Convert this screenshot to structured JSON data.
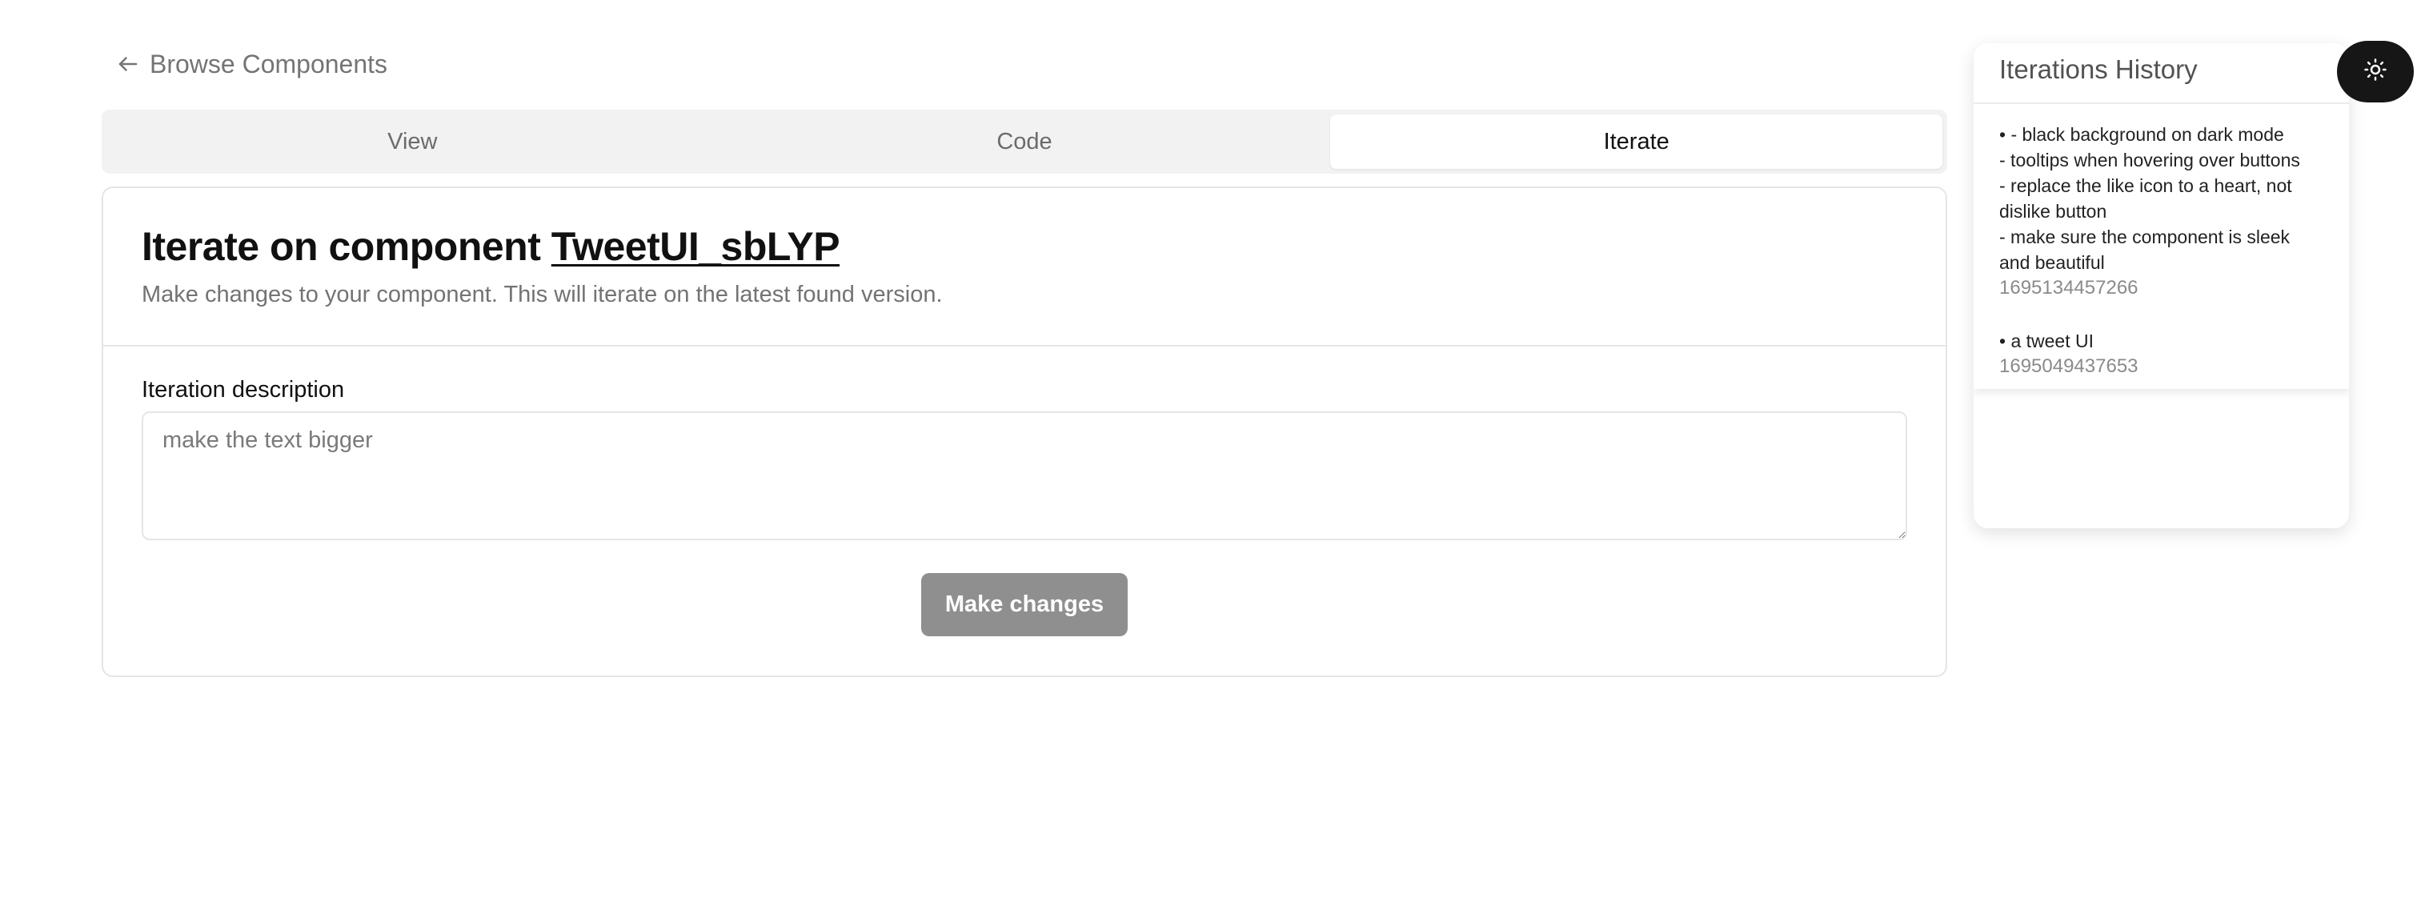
{
  "nav": {
    "back_label": "Browse Components",
    "back_icon": "arrow-left-icon"
  },
  "tabs": [
    {
      "label": "View",
      "active": false
    },
    {
      "label": "Code",
      "active": false
    },
    {
      "label": "Iterate",
      "active": true
    }
  ],
  "card": {
    "title_prefix": "Iterate on component ",
    "component_name": "TweetUI_sbLYP",
    "subtitle": "Make changes to your component. This will iterate on the latest found version.",
    "field_label": "Iteration description",
    "textarea_placeholder": "make the text bigger",
    "textarea_value": "",
    "submit_label": "Make changes"
  },
  "history": {
    "title": "Iterations History",
    "items": [
      {
        "text": "• - black background on dark mode\n- tooltips when hovering over buttons\n- replace the like icon to a heart, not dislike button\n- make sure the component is sleek and beautiful",
        "timestamp": "1695134457266"
      },
      {
        "text": "• a tweet UI",
        "timestamp": "1695049437653"
      }
    ]
  },
  "theme_toggle": {
    "icon": "sun-icon"
  },
  "colors": {
    "button_bg": "#8f8f8f",
    "tabs_bg": "#f2f2f2",
    "toggle_bg": "#161616",
    "muted_text": "#737373"
  }
}
